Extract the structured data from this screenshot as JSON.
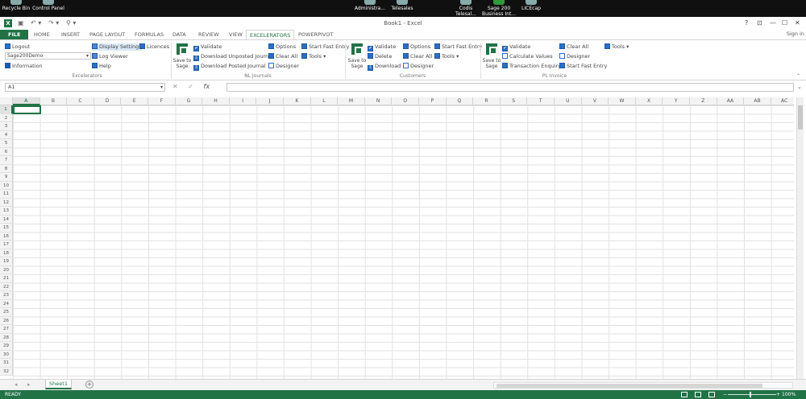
{
  "desktop": {
    "icons": [
      {
        "label": "Recycle Bin"
      },
      {
        "label": "Control Panel"
      },
      {
        "label": "Administra..."
      },
      {
        "label": "Telesales"
      },
      {
        "label": "Codis Telesal..."
      },
      {
        "label": "Sage 200 Business Int..."
      },
      {
        "label": "LICEcap"
      }
    ]
  },
  "window": {
    "title": "Book1 - Excel",
    "help": "?",
    "restore": "⊡",
    "minimize": "—",
    "maximize": "☐",
    "close": "✕"
  },
  "qat": {
    "save": "▣",
    "undo": "↶ ▾",
    "redo": "↷ ▾",
    "custom": "⚲ ▾"
  },
  "tabs": [
    "FILE",
    "HOME",
    "INSERT",
    "PAGE LAYOUT",
    "FORMULAS",
    "DATA",
    "REVIEW",
    "VIEW",
    "EXCELERATORS",
    "POWERPIVOT"
  ],
  "active_tab": "EXCELERATORS",
  "sign_in": "Sign in",
  "ribbon": {
    "excelerators": {
      "logout": "Logout",
      "company": "Sage200Demo",
      "information": "Information",
      "display_settings": "Display Settings",
      "licences": "Licences",
      "log_viewer": "Log Viewer",
      "help": "Help",
      "group": "Excelerators"
    },
    "nl_journals": {
      "save_to_sage": "Save to Sage",
      "validate": "Validate",
      "download_unposted": "Download Unposted Journal",
      "download_posted": "Download Posted Journal",
      "options": "Options",
      "clear_all": "Clear All",
      "designer": "Designer",
      "start_fast_entry": "Start Fast Entry",
      "tools": "Tools ▾",
      "group": "NL Journals"
    },
    "customers": {
      "save_to_sage": "Save to Sage",
      "validate": "Validate",
      "delete": "Delete",
      "download": "Download",
      "options": "Options",
      "clear_all": "Clear All",
      "designer": "Designer",
      "start_fast_entry": "Start Fast Entry",
      "tools": "Tools ▾",
      "group": "Customers"
    },
    "pl_invoice": {
      "save_to_sage": "Save to Sage",
      "validate": "Validate",
      "calculate_values": "Calculate Values",
      "transaction_enquiry": "Transaction Enquiry",
      "clear_all": "Clear All",
      "designer": "Designer",
      "start_fast_entry": "Start Fast Entry",
      "tools": "Tools ▾",
      "group": "PL Invoice"
    }
  },
  "formula_bar": {
    "name_box": "A1",
    "cancel": "✕",
    "enter": "✓",
    "fx": "fx",
    "value": ""
  },
  "columns": [
    "A",
    "B",
    "C",
    "D",
    "E",
    "F",
    "G",
    "H",
    "I",
    "J",
    "K",
    "L",
    "M",
    "N",
    "O",
    "P",
    "Q",
    "R",
    "S",
    "T",
    "U",
    "V",
    "W",
    "X",
    "Y",
    "Z",
    "AA",
    "AB",
    "AC"
  ],
  "rows": [
    "1",
    "2",
    "3",
    "4",
    "5",
    "6",
    "7",
    "8",
    "9",
    "10",
    "11",
    "12",
    "13",
    "14",
    "15",
    "16",
    "17",
    "18",
    "19",
    "20",
    "21",
    "22",
    "23",
    "24",
    "25",
    "26",
    "27",
    "28",
    "29",
    "30",
    "31",
    "32"
  ],
  "sheets": [
    "Sheet1"
  ],
  "add_sheet": "+",
  "status": {
    "ready": "READY",
    "zoom": "100%",
    "zoom_minus": "−",
    "zoom_plus": "+"
  }
}
